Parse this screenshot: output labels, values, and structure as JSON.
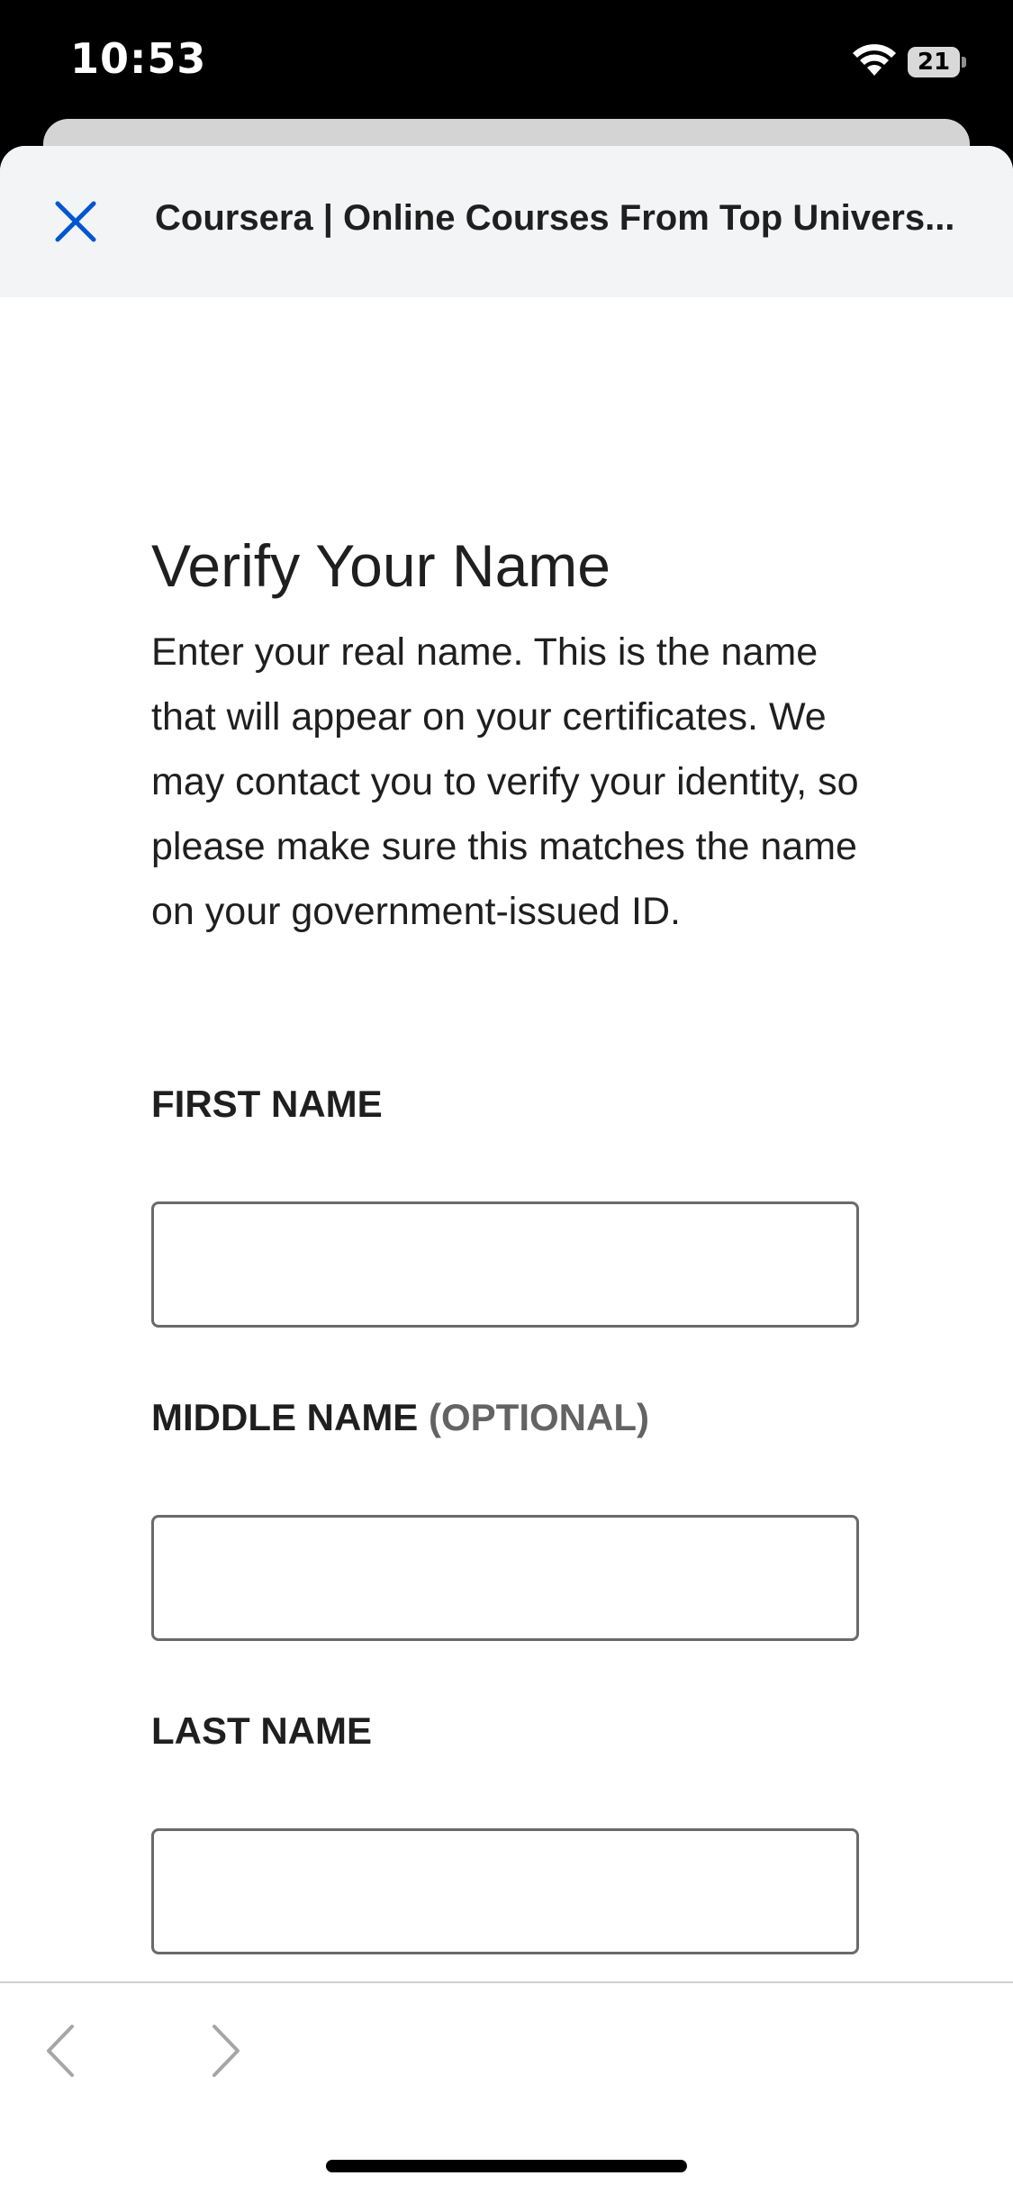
{
  "status_bar": {
    "time": "10:53",
    "battery_level": "21"
  },
  "header": {
    "title": "Coursera | Online Courses From Top Univers...",
    "close_icon": "close-icon"
  },
  "form": {
    "title": "Verify Your Name",
    "intro": "Enter your real name. This is the name that will appear on your certificates. We may contact you to verify your identity, so please make sure this matches the name on your government-issued ID.",
    "first_name": {
      "label": "FIRST NAME",
      "value": ""
    },
    "middle_name": {
      "label": "MIDDLE NAME",
      "optional": "(OPTIONAL)",
      "value": ""
    },
    "last_name": {
      "label": "LAST NAME",
      "value": ""
    }
  },
  "bottom_bar": {
    "back_icon": "chevron-left-icon",
    "forward_icon": "chevron-right-icon"
  },
  "colors": {
    "accent": "#0056d2",
    "text": "#1f1f1f",
    "header_bg": "#f3f4f6"
  }
}
